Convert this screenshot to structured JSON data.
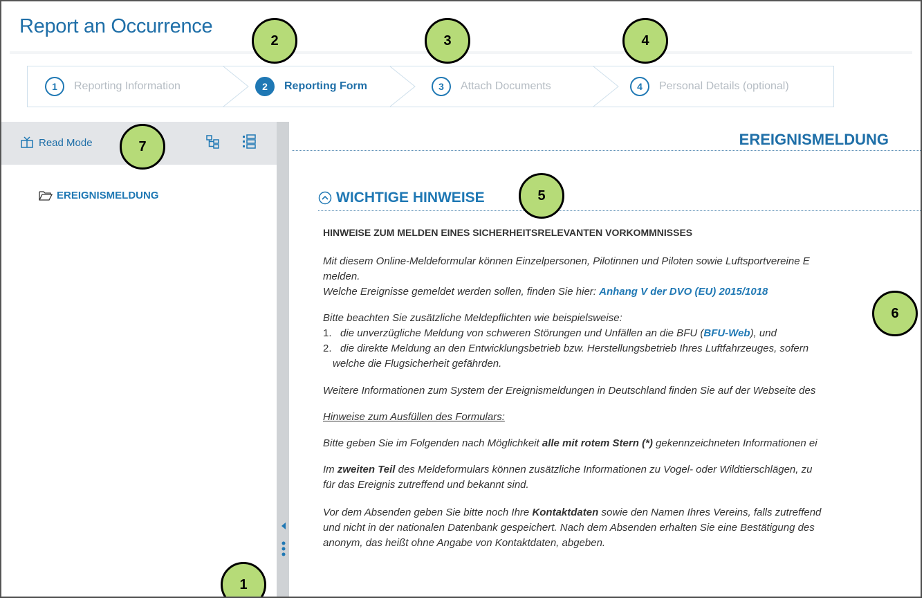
{
  "app": {
    "title": "Report an Occurrence"
  },
  "stepper": {
    "steps": [
      {
        "number": "1",
        "label": "Reporting Information"
      },
      {
        "number": "2",
        "label": "Reporting Form"
      },
      {
        "number": "3",
        "label": "Attach Documents"
      },
      {
        "number": "4",
        "label": "Personal Details (optional)"
      }
    ],
    "active_step": 2
  },
  "sidebar": {
    "read_mode_label": "Read Mode",
    "toolbar_icons": [
      "read-mode-icon",
      "tree-view-icon",
      "list-view-icon"
    ],
    "tree": [
      {
        "label": "EREIGNISMELDUNG",
        "icon": "folder-open-icon"
      }
    ]
  },
  "content": {
    "doc_title": "EREIGNISMELDUNG",
    "section_title": "WICHTIGE HINWEISE",
    "heading": "HINWEISE ZUM MELDEN EINES SICHERHEITSRELEVANTEN VORKOMMNISSES",
    "p1_line1": "Mit diesem Online-Meldeformular können Einzelpersonen, Pilotinnen und Piloten sowie Luftsportvereine E",
    "p1_line2": "melden.",
    "p1_line3_prefix": "Welche Ereignisse gemeldet werden sollen, finden Sie hier: ",
    "p1_line3_link": "Anhang V der DVO (EU) 2015/1018",
    "p2_intro": "Bitte beachten Sie zusätzliche Meldepflichten wie beispielsweise:",
    "list_item1_num": "1.",
    "list_item1_prefix": "die unverzügliche Meldung von schweren Störungen und Unfällen an die BFU (",
    "list_item1_link": "BFU-Web",
    "list_item1_suffix": "), und",
    "list_item2_num": "2.",
    "list_item2_line1": "die direkte Meldung an den Entwicklungsbetrieb bzw. Herstellungsbetrieb Ihres Luftfahrzeuges, sofern",
    "list_item2_line2": "welche die Flugsicherheit gefährden.",
    "p3": "Weitere Informationen zum System der Ereignismeldungen in Deutschland finden Sie auf der Webseite des",
    "p4": "Hinweise zum Ausfüllen des Formulars:",
    "p5_prefix": "Bitte geben Sie im Folgenden nach Möglichkeit ",
    "p5_bold": "alle mit rotem Stern (*)",
    "p5_suffix": " gekennzeichneten Informationen ei",
    "p6_prefix": "Im ",
    "p6_bold": "zweiten Teil",
    "p6_suffix": " des Meldeformulars können zusätzliche Informationen zu Vogel- oder Wildtierschlägen, zu",
    "p6_line2": "für das Ereignis zutreffend und bekannt sind.",
    "p7_prefix": "Vor dem Absenden geben Sie bitte noch Ihre ",
    "p7_bold": "Kontaktdaten",
    "p7_suffix": " sowie den Namen Ihres Vereins, falls zutreffend",
    "p7_line2": "und nicht in der nationalen Datenbank gespeichert. Nach dem Absenden erhalten Sie eine Bestätigung des",
    "p7_line3": "anonym, das heißt ohne Angabe von Kontaktdaten, abgeben."
  },
  "callouts": [
    "1",
    "2",
    "3",
    "4",
    "5",
    "6",
    "7"
  ],
  "colors": {
    "accent": "#1f78b4",
    "title": "#1f6fa8",
    "callout_fill": "#b6db78",
    "sidebar_toolbar": "#e3e5e8",
    "splitter": "#cfd2d5"
  }
}
